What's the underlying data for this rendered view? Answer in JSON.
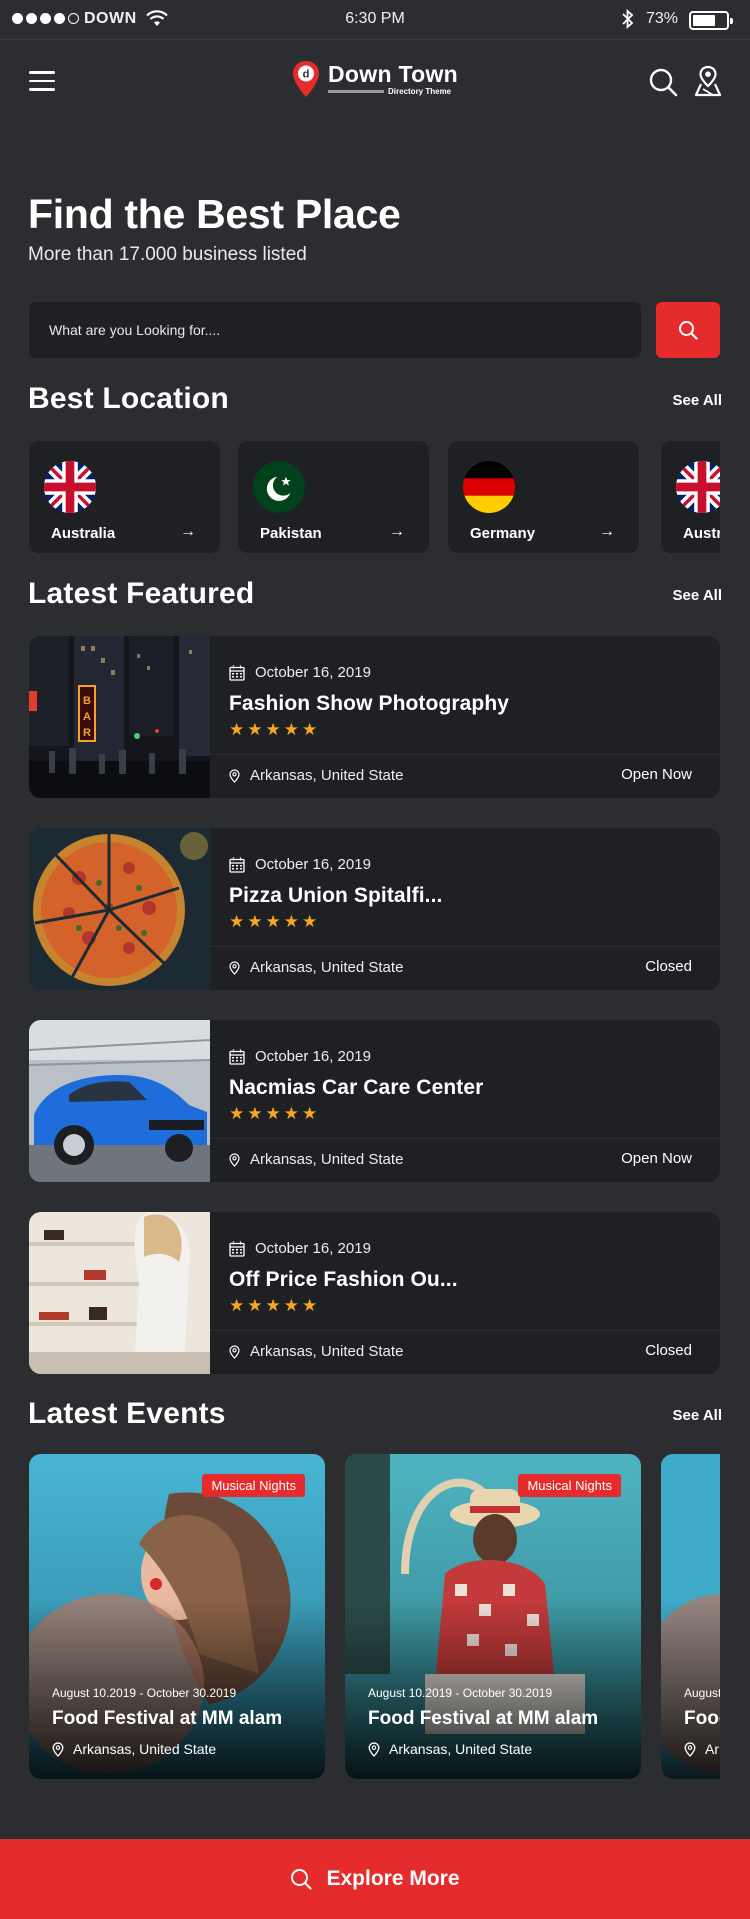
{
  "status_bar": {
    "carrier": "DOWN",
    "time": "6:30 PM",
    "battery": "73%"
  },
  "header": {
    "brand_name": "Down Town",
    "brand_tagline": "Directory Theme",
    "logo_letter": "d"
  },
  "hero": {
    "title": "Find the Best Place",
    "subtitle": "More than 17.000 business listed"
  },
  "search": {
    "placeholder": "What are you Looking for...."
  },
  "best_location": {
    "title": "Best Location",
    "see_all": "See All",
    "items": [
      {
        "name": "Australia",
        "flag": "uk-flag-icon"
      },
      {
        "name": "Pakistan",
        "flag": "pakistan-flag-icon"
      },
      {
        "name": "Germany",
        "flag": "germany-flag-icon"
      },
      {
        "name": "Austr",
        "flag": "uk-flag-icon"
      }
    ]
  },
  "latest_featured": {
    "title": "Latest Featured",
    "see_all": "See All",
    "items": [
      {
        "date": "October 16, 2019",
        "title": "Fashion Show Photography",
        "location": "Arkansas, United State",
        "status": "Open Now",
        "rating": 5
      },
      {
        "date": "October 16, 2019",
        "title": "Pizza Union Spitalfi...",
        "location": "Arkansas, United State",
        "status": "Closed",
        "rating": 5
      },
      {
        "date": "October 16, 2019",
        "title": "Nacmias Car Care Center",
        "location": "Arkansas, United State",
        "status": "Open Now",
        "rating": 5
      },
      {
        "date": "October 16, 2019",
        "title": "Off Price Fashion Ou...",
        "location": "Arkansas, United State",
        "status": "Closed",
        "rating": 5
      }
    ]
  },
  "latest_events": {
    "title": "Latest Events",
    "see_all": "See All",
    "items": [
      {
        "badge": "Musical Nights",
        "dates": "August 10.2019  -  October 30.2019",
        "title": "Food Festival at MM alam",
        "location": "Arkansas, United State"
      },
      {
        "badge": "Musical Nights",
        "dates": "August 10.2019  -  October 30.2019",
        "title": "Food Festival at MM alam",
        "location": "Arkansas, United State"
      },
      {
        "badge": "",
        "dates": "August",
        "title": "Food",
        "location": "Ar"
      }
    ]
  },
  "explore_button": {
    "label": "Explore More"
  },
  "colors": {
    "accent": "#e52b2b",
    "background": "#2c2d31",
    "card": "#1f2023",
    "star": "#f5a623"
  }
}
